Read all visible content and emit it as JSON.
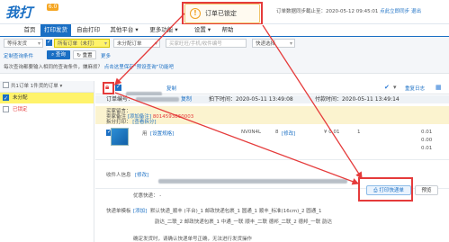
{
  "app": {
    "logo": "我打",
    "version_badge": "6.0"
  },
  "toast": {
    "text": "订单已锁定"
  },
  "header": {
    "sync_text": "订单数据同步截止至：2020-05-12 09:45:01",
    "link_1": "点此立即同步",
    "link_2": "退出"
  },
  "nav": {
    "items": [
      {
        "label": "首页"
      },
      {
        "label": "打印发货"
      },
      {
        "label": "自由打印"
      },
      {
        "label": "其他平台 ▾"
      },
      {
        "label": "更多功能 ▾"
      },
      {
        "label": "设置 ▾"
      },
      {
        "label": "帮助"
      }
    ]
  },
  "filters": {
    "status_select": "等待发货",
    "flag_select": "所有订单（未打）",
    "type_select": "未分配订单",
    "buyer_placeholder": "买家旺旺/手机/收件编号",
    "express_select": "快递选择",
    "save_query_link": "定制查询条件",
    "query_button": "查询",
    "reset_button": "重置",
    "batch_link": "更多",
    "hint_text": "每次查询都要输入相同的查询条件，嫌麻烦？",
    "hint_link": "点击这里保存“预设查询”功能吧"
  },
  "left": {
    "header_text": "共1订单 1件货的订单 ▾",
    "rows": [
      {
        "text": "未分配"
      },
      {
        "text": "已锁定"
      }
    ]
  },
  "main": {
    "toolbar": {
      "lock_icon": "lock-icon",
      "copy_link": "复制",
      "select_all": "全选",
      "right_link": "重复日志"
    },
    "order_info": {
      "order_no_label": "订单编号：",
      "copy_link": "复制",
      "paid_label": "拍下时间：2020-05-11 13:49:08",
      "pay_label": "付款时间：2020-05-11 13:49:14"
    },
    "notice": {
      "line1": "买家留言：",
      "line2_label": "卖家备注",
      "line2_link": "[添加备注]",
      "line2_value": "8014593860003",
      "line3": "拆分打印：",
      "line3_link": "[查看拆分]"
    },
    "product": {
      "name": "用",
      "modify_link": "[设置规格]",
      "sku": "NV0N4L",
      "qty": "8",
      "qty_link": "[修改]",
      "price": "¥ 0.01",
      "price_2": "1",
      "sub_1": "0.01",
      "sub_2": "0.00",
      "sub_3": "0.01"
    },
    "recipient": {
      "label": "收件人信息",
      "link": "[修改]"
    },
    "merchant_note": {
      "label": "优惠快递：",
      "value": "-"
    },
    "express": {
      "label": "快递单模板",
      "link": "[添加]",
      "options_row1": [
        "默认快递_顺丰 (平台)_1",
        "邮政快递包裹_1",
        "圆通_1",
        "顺丰_标准(16cm)_2",
        "圆通_1"
      ],
      "options_row2": [
        "韵达_二联_2",
        "邮政快递包裹_1",
        "中通_一联",
        "顺丰_二联",
        "德邦_二联_2",
        "德邦_一联",
        "韵达"
      ]
    },
    "print_button": "打印快递单",
    "preview_button": "预览",
    "footer_text": "确定发货时，请确认快递单号正确，无法进行发货操作"
  }
}
